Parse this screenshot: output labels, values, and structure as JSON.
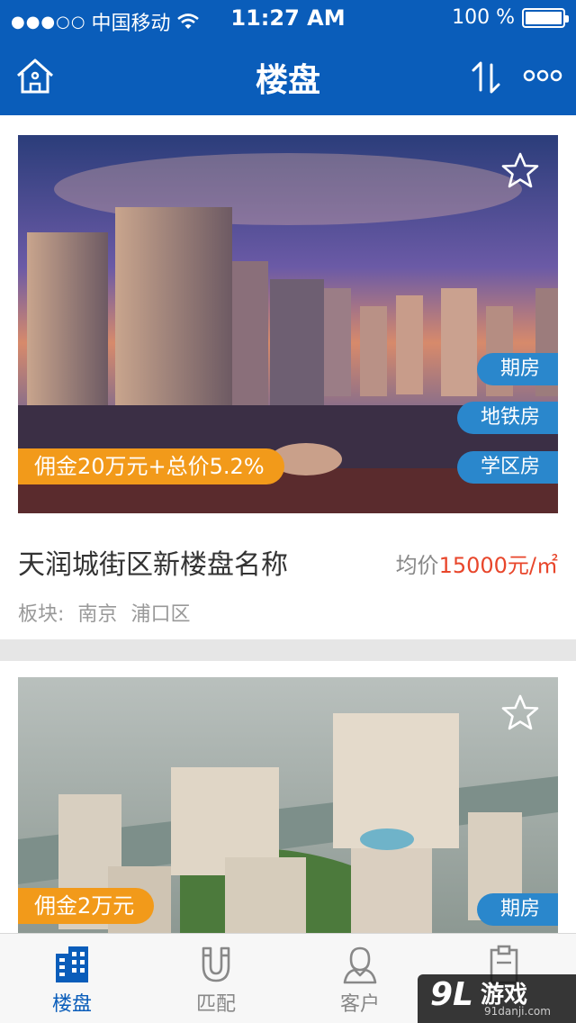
{
  "status": {
    "carrier": "中国移动",
    "signal_dots": "●●●○○",
    "time": "11:27 AM",
    "battery": "100 %"
  },
  "header": {
    "title": "楼盘",
    "home_icon": "home-icon",
    "sort_icon": "sort-icon",
    "more_icon": "more-icon"
  },
  "listings": [
    {
      "commission": "佣金20万元+总价5.2%",
      "tags": [
        "期房",
        "地铁房",
        "学区房"
      ],
      "name": "天润城街区新楼盘名称",
      "price_label": "均价",
      "price_value": "15000元/㎡",
      "district_label": "板块:",
      "district_city": "南京",
      "district_area": "浦口区"
    },
    {
      "commission": "佣金2万元",
      "tags": [
        "期房"
      ]
    }
  ],
  "tabbar": {
    "tabs": [
      {
        "label": "楼盘",
        "icon": "building-icon",
        "active": true
      },
      {
        "label": "匹配",
        "icon": "magnet-icon",
        "active": false
      },
      {
        "label": "客户",
        "icon": "person-icon",
        "active": false
      },
      {
        "label": "",
        "icon": "clipboard-icon",
        "active": false
      }
    ]
  },
  "watermark": {
    "logo": "9L",
    "text": "游戏",
    "url": "91danji.com"
  },
  "colors": {
    "brand_blue": "#0a5dba",
    "commission_orange": "#f29a1a",
    "tag_blue": "#2a87cc",
    "price_red": "#e8462b"
  }
}
